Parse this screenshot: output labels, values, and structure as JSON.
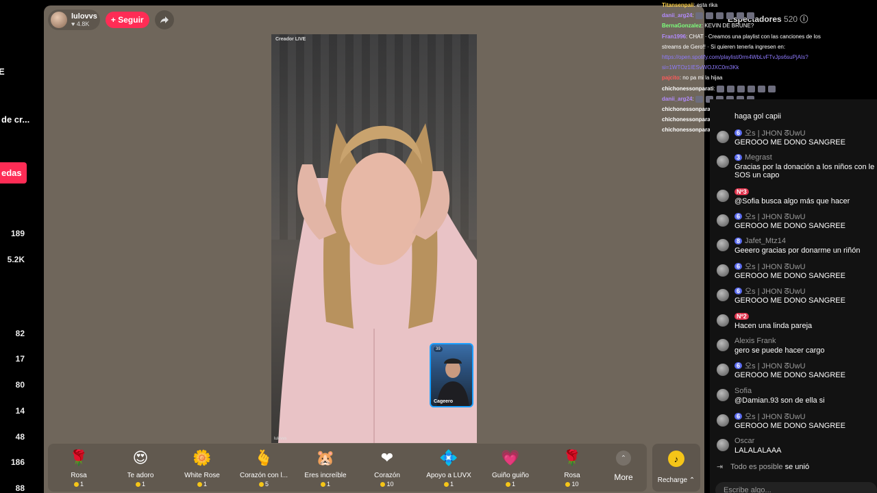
{
  "left_sidebar": {
    "texts": [
      "E",
      "de cr...",
      "edas"
    ],
    "numbers": [
      "189",
      "5.2K",
      "82",
      "17",
      "80",
      "14",
      "48",
      "186",
      "88"
    ]
  },
  "host": {
    "name": "lulovvs",
    "likes": "♥ 4.8K",
    "follow_label": "+ Seguir"
  },
  "video": {
    "watermark": "Creador LIVE",
    "bottom_tag": "lulovvs",
    "pip_name": "Cageero",
    "pip_count": "39"
  },
  "gifts": [
    {
      "name": "Rosa",
      "price": "1",
      "icon": "🌹"
    },
    {
      "name": "Te adoro",
      "price": "1",
      "icon": "😍"
    },
    {
      "name": "White Rose",
      "price": "1",
      "icon": "🌼"
    },
    {
      "name": "Corazón con l...",
      "price": "5",
      "icon": "🫰"
    },
    {
      "name": "Eres increíble",
      "price": "1",
      "icon": "🐹"
    },
    {
      "name": "Corazón",
      "price": "10",
      "icon": "❤"
    },
    {
      "name": "Apoyo a LUVX",
      "price": "1",
      "icon": "💠"
    },
    {
      "name": "Guiño guiño",
      "price": "1",
      "icon": "💗"
    },
    {
      "name": "Rosa",
      "price": "10",
      "icon": "🌹"
    }
  ],
  "more_label": "More",
  "recharge_label": "Recharge ⌃",
  "viewers": {
    "label": "Espectadores",
    "count": "520"
  },
  "overlay_chat": [
    {
      "user": "Titansenpaii",
      "color": "#ffd24a",
      "text": ": esta rika"
    },
    {
      "user": "danii_arg24",
      "color": "#b38bff",
      "text": ": "
    },
    {
      "user": "BernaGonzalez",
      "color": "#7cff7c",
      "text": ": KEVIN DE BRUNE?"
    },
    {
      "user": "Fran1996",
      "color": "#b38bff",
      "text": ": CHAT · Creamos una playlist con las canciones de los"
    },
    {
      "user": "",
      "color": "#fff",
      "text": "streams de Gero!! · Si quieren tenerla ingresen en:"
    },
    {
      "user": "",
      "color": "#8f7bff",
      "text": "https://open.spotify.com/playlist/0rm4WbLvFTvJps6suPjAIs?"
    },
    {
      "user": "",
      "color": "#8f7bff",
      "text": "si=1WTOz1IESvWOJXC0m3Kk"
    },
    {
      "user": "pajcito",
      "color": "#ff5b5b",
      "text": ": no pa mi la hijaa"
    },
    {
      "user": "chichonessonparati",
      "color": "#fff",
      "text": ": "
    },
    {
      "user": "danii_arg24",
      "color": "#b38bff",
      "text": ": "
    },
    {
      "user": "chichonessonparati",
      "color": "#fff",
      "text": ": "
    },
    {
      "user": "chichonessonparati",
      "color": "#fff",
      "text": ": "
    },
    {
      "user": "chichonessonparati",
      "color": "#fff",
      "text": ": "
    }
  ],
  "chat": [
    {
      "user": "",
      "level": "",
      "text": "haga gol capii"
    },
    {
      "user": "오s | JHON ᘔUwU",
      "level": "6",
      "text": "GEROOO ME DONO SANGREE"
    },
    {
      "user": "Megrast",
      "level": "3",
      "text": "Gracias por la donación a los niños con le"
    },
    {
      "user": "",
      "level": "",
      "text": "SOS un capo"
    },
    {
      "user": "",
      "level": "Nº3",
      "text": "@Sofia busca algo más que hacer"
    },
    {
      "user": "오s | JHON ᘔUwU",
      "level": "6",
      "text": "GEROOO ME DONO SANGREE"
    },
    {
      "user": "Jafet_Mtz14",
      "level": "8",
      "text": "Geeero gracias por donarme un riñón"
    },
    {
      "user": "오s | JHON ᘔUwU",
      "level": "6",
      "text": "GEROOO ME DONO SANGREE"
    },
    {
      "user": "오s | JHON ᘔUwU",
      "level": "6",
      "text": "GEROOO ME DONO SANGREE"
    },
    {
      "user": "",
      "level": "Nº2",
      "text": "Hacen una linda pareja"
    },
    {
      "user": "Alexis Frank",
      "level": "",
      "text": "gero se puede hacer cargo"
    },
    {
      "user": "오s | JHON ᘔUwU",
      "level": "6",
      "text": "GEROOO ME DONO SANGREE"
    },
    {
      "user": "Sofia",
      "level": "",
      "text": "@Damian.93 son de ella si"
    },
    {
      "user": "오s | JHON ᘔUwU",
      "level": "6",
      "text": "GEROOO ME DONO SANGREE"
    },
    {
      "user": "Oscar",
      "level": "",
      "text": "LALALALAAA"
    }
  ],
  "join_notice": {
    "user": "Todo es posible",
    "text": "se unió"
  },
  "chat_input_placeholder": "Escribe algo..."
}
